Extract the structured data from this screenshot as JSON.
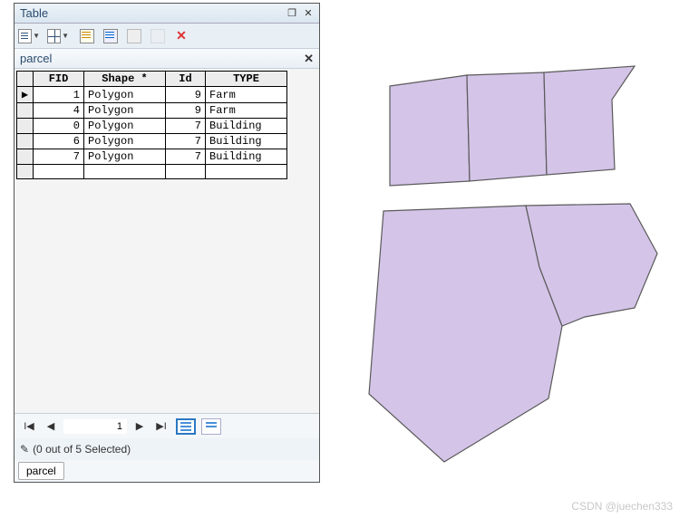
{
  "window": {
    "title": "Table",
    "restore_tooltip": "Restore",
    "close_tooltip": "Close"
  },
  "toolbar": {
    "list_options": "List Options",
    "related_tables": "Related Tables",
    "select_by_attributes": "Select By Attributes",
    "switch_selection": "Switch Selection",
    "clear_selection": "Clear Selection",
    "zoom_selected": "Zoom To Selected",
    "delete_selected": "Delete Selected"
  },
  "layer": {
    "name": "parcel",
    "close_tooltip": "Close"
  },
  "grid": {
    "columns": [
      "FID",
      "Shape *",
      "Id",
      "TYPE"
    ],
    "rows": [
      {
        "fid": "1",
        "shape": "Polygon",
        "id": "9",
        "type": "Farm",
        "current": true
      },
      {
        "fid": "4",
        "shape": "Polygon",
        "id": "9",
        "type": "Farm",
        "current": false
      },
      {
        "fid": "0",
        "shape": "Polygon",
        "id": "7",
        "type": "Building",
        "current": false
      },
      {
        "fid": "6",
        "shape": "Polygon",
        "id": "7",
        "type": "Building",
        "current": false
      },
      {
        "fid": "7",
        "shape": "Polygon",
        "id": "7",
        "type": "Building",
        "current": false
      }
    ]
  },
  "nav": {
    "first": "⏮",
    "prev": "◀",
    "position": "1",
    "next": "▶",
    "last": "⏭",
    "show_all": "Show All",
    "show_selected": "Show Selected"
  },
  "status": {
    "text": "(0 out of 5 Selected)"
  },
  "tab": {
    "label": "parcel"
  },
  "map": {
    "fill": "#d4c4e8",
    "stroke": "#5a5a5a"
  },
  "watermark": "CSDN @juechen333"
}
